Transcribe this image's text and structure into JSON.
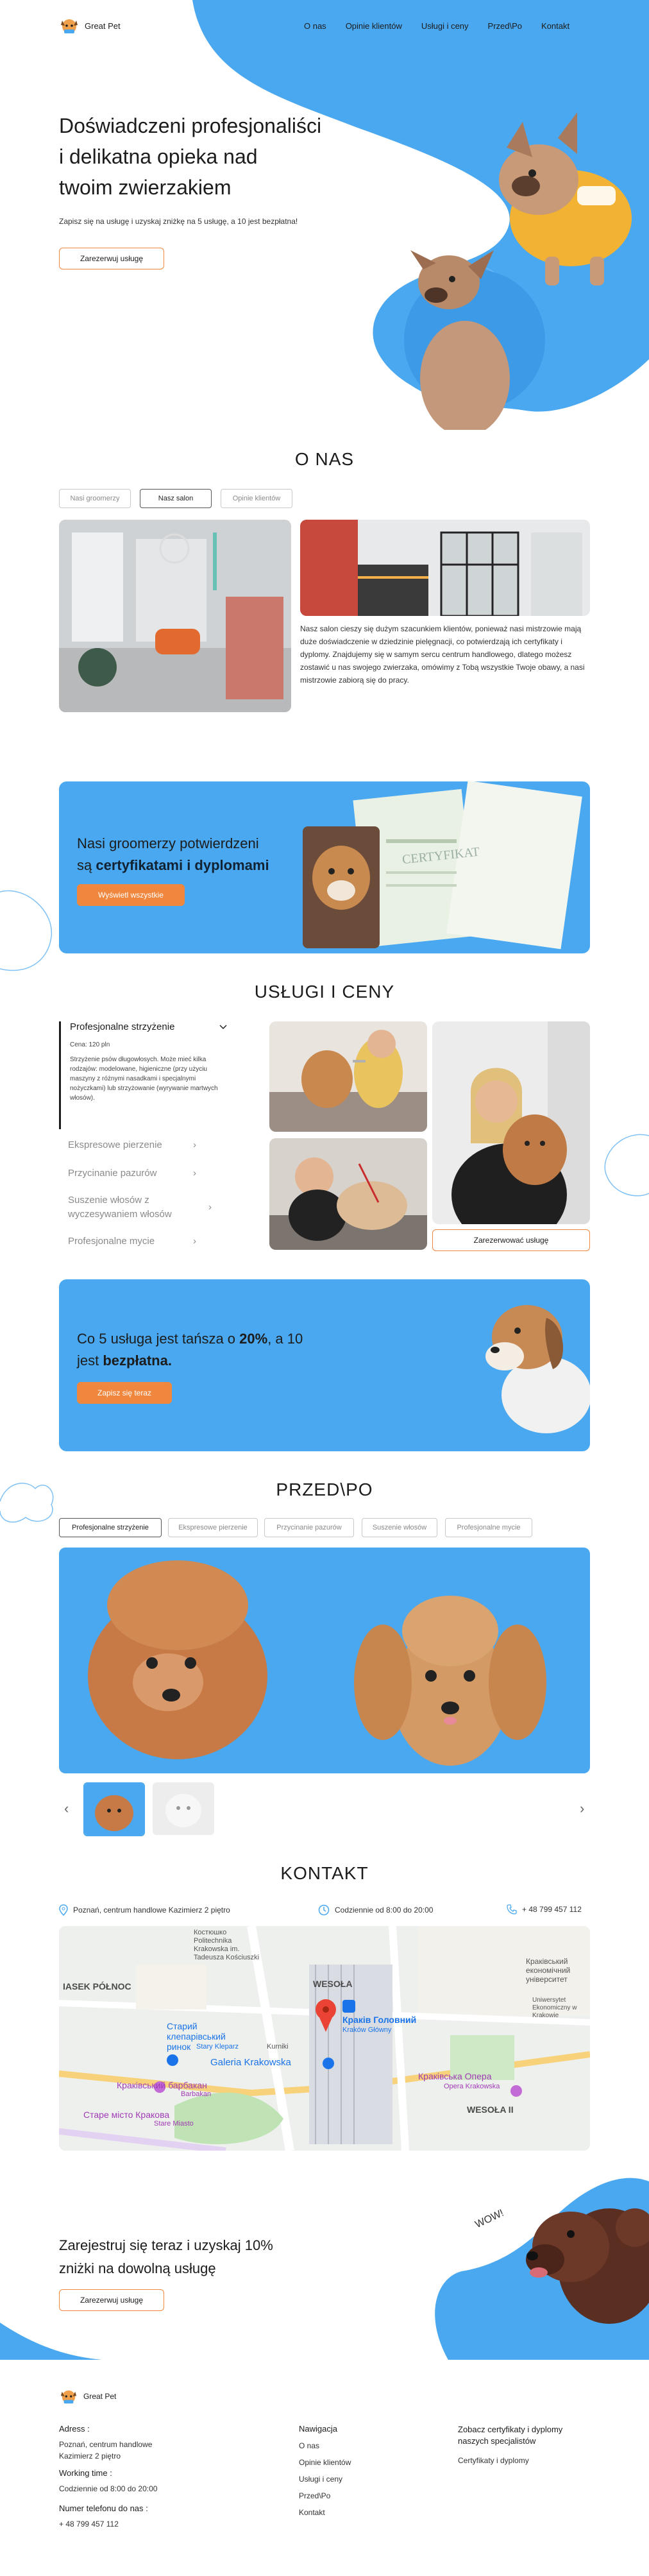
{
  "brand": {
    "name": "Great Pet"
  },
  "nav": [
    "O nas",
    "Opinie klientów",
    "Usługi i ceny",
    "Przed\\Po",
    "Kontakt"
  ],
  "hero": {
    "title_l1": "Doświadczeni profesjonaliści",
    "title_l2": "i delikatna opieka nad",
    "title_l3": "twoim zwierzakiem",
    "subtitle": "Zapisz się na usługę i uzyskaj zniżkę na 5 usługę, a 10 jest bezpłatna!",
    "cta": "Zarezerwuj usługę"
  },
  "about": {
    "title": "O NAS",
    "tabs": [
      "Nasi groomerzy",
      "Nasz salon",
      "Opinie klientów"
    ],
    "text": "Nasz salon cieszy się dużym szacunkiem klientów, ponieważ nasi mistrzowie mają duże doświadczenie w dziedzinie pielęgnacji, co potwierdzają ich certyfikaty i dyplomy. Znajdujemy się w samym sercu centrum handlowego, dlatego możesz zostawić u nas swojego zwierzaka, omówimy z Tobą wszystkie Twoje obawy, a nasi mistrzowie zabiorą się do pracy."
  },
  "certs": {
    "line1": "Nasi groomerzy potwierdzeni",
    "line2_pre": "są ",
    "line2_bold": "certyfikatami i dyplomami",
    "button": "Wyświetl wszystkie",
    "cert_word": "CERTYFIKAT"
  },
  "services": {
    "title": "USŁUGI I CENY",
    "open_item": "Profesjonalne strzyżenie",
    "price": "Cena: 120 pln",
    "desc": "Strzyżenie psów długowłosych. Może mieć kilka rodzajów: modelowane, higieniczne (przy użyciu maszyny z różnymi nasadkami i specjalnymi nożyczkami) lub strzyżowanie (wyrywanie martwych włosów).",
    "items": [
      "Ekspresowe pierzenie",
      "Przycinanie pazurów",
      "Suszenie włosów z wyczesywaniem włosów",
      "Profesjonalne mycie"
    ],
    "book_button": "Zarezerwować usługę"
  },
  "promo": {
    "pre": "Co 5 usługa jest tańsza o ",
    "pct": "20%",
    "mid": ", a 10",
    "line2_pre": "jest ",
    "free": "bezpłatna.",
    "button": "Zapisz się teraz"
  },
  "beforeafter": {
    "title": "PRZED\\PO",
    "tabs": [
      "Profesjonalne strzyżenie",
      "Ekspresowe pierzenie",
      "Przycinanie pazurów",
      "Suszenie włosów",
      "Profesjonalne mycie"
    ]
  },
  "contact": {
    "title": "KONTAKT",
    "address": "Poznań, centrum handlowe Kazimierz 2 piętro",
    "hours": "Codziennie od 8:00 do 20:00",
    "phone": "+ 48 799 457 112",
    "map_labels": {
      "l1": "IASEK PÓŁNOC",
      "l2": "Старий клепарівський ринок",
      "l3": "Stary Kleparz",
      "l4": "Galeria Krakowska",
      "l5": "Краківський барбакан",
      "l6": "Barbakan",
      "l7": "Старе місто Кракова",
      "l8": "Stare Miasto",
      "l9": "Краків Головний",
      "l10": "Kraków Główny",
      "l11": "WESOŁA",
      "l12": "Kurniki",
      "l13": "Краківська Опера",
      "l14": "Opera Krakowska",
      "l15": "WESOŁA II",
      "l16": "Краківський економічний університет",
      "l17": "Uniwersytet Ekonomiczny w Krakowie",
      "l18": "Костюшко Politechnika Krakowska im. Tadeusza Kościuszki"
    }
  },
  "cta2": {
    "line1": "Zarejestruj się teraz i uzyskaj 10%",
    "line2": "zniżki na dowolną usługę",
    "button": "Zarezerwuj usługę",
    "wow": "WOW!"
  },
  "footer": {
    "brand": "Great Pet",
    "address_label": "Adress :",
    "address": "Poznań, centrum handlowe Kazimierz 2 piętro",
    "working_label": "Working time :",
    "working": "Codziennie od 8:00 do 20:00",
    "phone_label": "Numer telefonu do nas :",
    "phone": "+ 48 799 457 112",
    "nav_label": "Nawigacja",
    "nav": [
      "O nas",
      "Opinie klientów",
      "Usługi i ceny",
      "Przed\\Po",
      "Kontakt"
    ],
    "certs_label": "Zobacz certyfikaty i dyplomy naszych specjalistów",
    "certs_link": "Certyfikaty i dyplomy"
  },
  "colors": {
    "blue": "#4aa8f0",
    "orange": "#f0873e",
    "text": "#1c1c1c"
  }
}
